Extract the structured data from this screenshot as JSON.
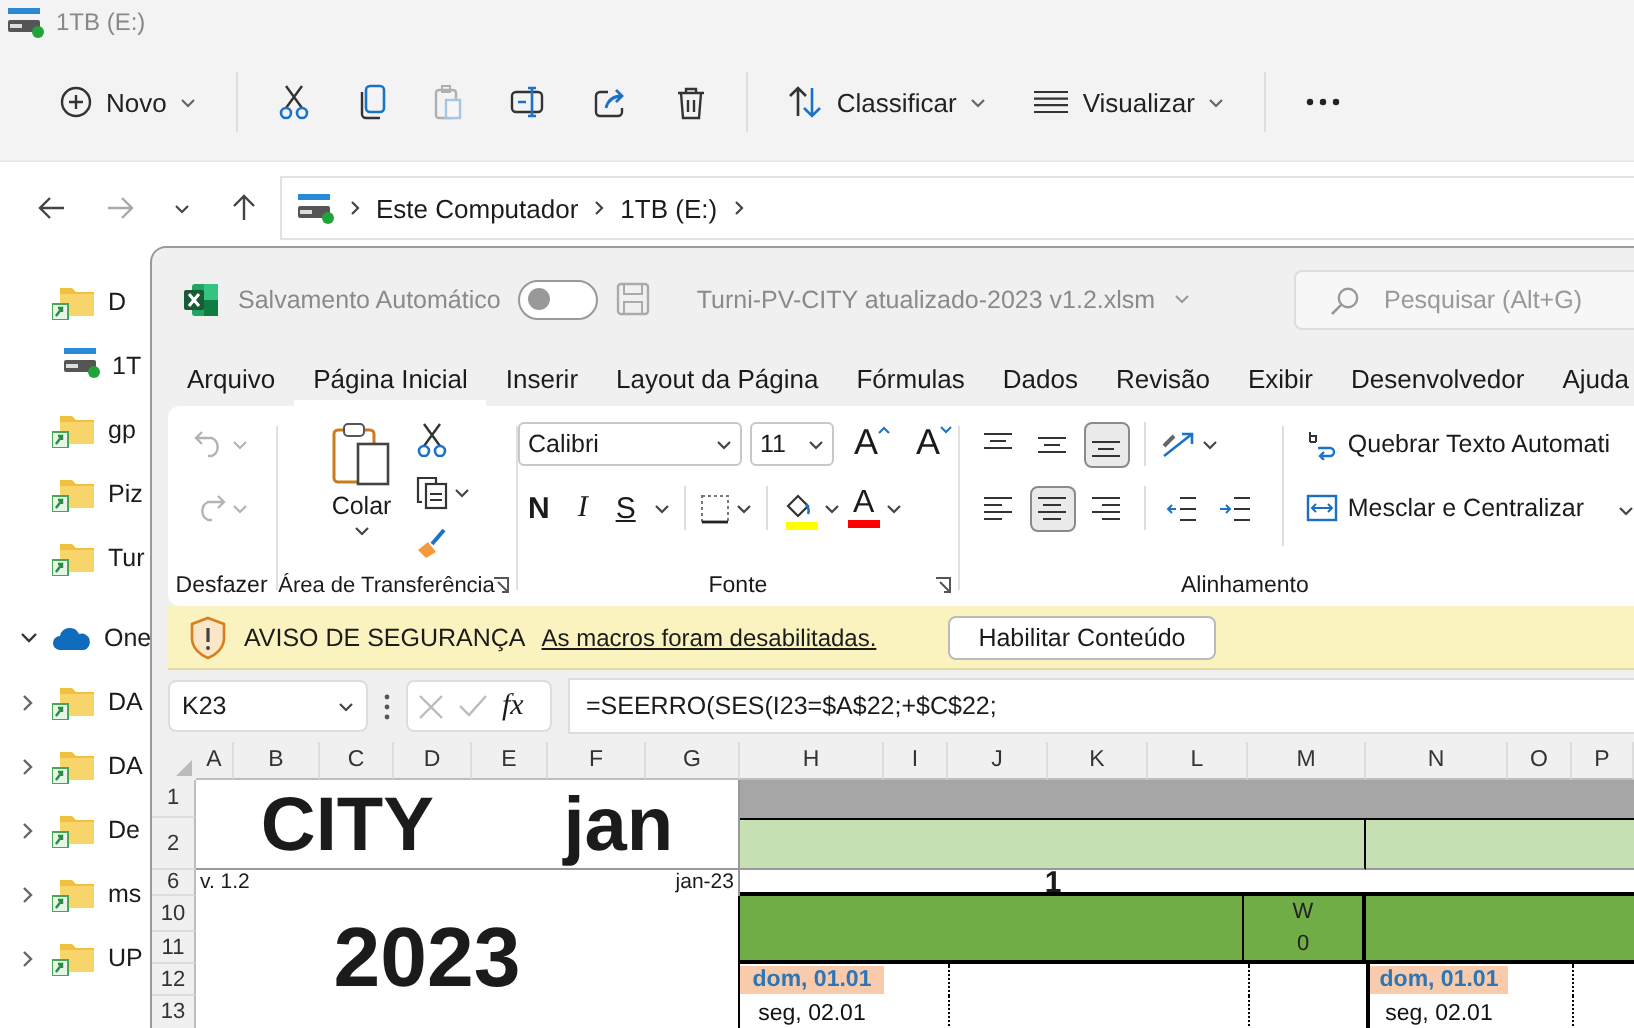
{
  "explorer": {
    "title": "1TB (E:)",
    "toolbar": [
      [
        {
          "kind": "new",
          "label": "Novo",
          "disabled": false
        }
      ],
      [
        {
          "kind": "cut",
          "disabled": false
        },
        {
          "kind": "copy",
          "disabled": false
        },
        {
          "kind": "paste",
          "disabled": true
        },
        {
          "kind": "rename",
          "disabled": false
        },
        {
          "kind": "share",
          "disabled": false
        },
        {
          "kind": "delete",
          "disabled": false
        }
      ],
      [
        {
          "kind": "sort",
          "label": "Classificar",
          "disabled": false
        },
        {
          "kind": "view",
          "label": "Visualizar",
          "disabled": false
        }
      ],
      [
        {
          "kind": "more",
          "disabled": false
        }
      ]
    ],
    "address": {
      "crumbs": [
        "Este Computador",
        "1TB (E:)"
      ]
    },
    "sidebar": [
      {
        "kind": "folder",
        "label": "D"
      },
      {
        "kind": "drive",
        "label": "1T"
      },
      {
        "kind": "folder",
        "label": "gp"
      },
      {
        "kind": "folder",
        "label": "Piz"
      },
      {
        "kind": "folder",
        "label": "Tur"
      },
      {
        "kind": "cloud",
        "label": "One",
        "expanded": true
      },
      {
        "kind": "folder",
        "label": "DA",
        "expanded": false
      },
      {
        "kind": "folder",
        "label": "DA",
        "expanded": false
      },
      {
        "kind": "folder",
        "label": "De",
        "expanded": false
      },
      {
        "kind": "folder",
        "label": "ms",
        "expanded": false
      },
      {
        "kind": "folder",
        "label": "UP",
        "expanded": false
      }
    ]
  },
  "excel": {
    "autosave": {
      "label": "Salvamento Automático",
      "on": false
    },
    "filename": "Turni-PV-CITY atualizado-2023 v1.2.xlsm",
    "search": {
      "placeholder": "Pesquisar (Alt+G)"
    },
    "tabs": [
      {
        "label": "Arquivo",
        "selected": false
      },
      {
        "label": "Página Inicial",
        "selected": true
      },
      {
        "label": "Inserir",
        "selected": false
      },
      {
        "label": "Layout da Página",
        "selected": false
      },
      {
        "label": "Fórmulas",
        "selected": false
      },
      {
        "label": "Dados",
        "selected": false
      },
      {
        "label": "Revisão",
        "selected": false
      },
      {
        "label": "Exibir",
        "selected": false
      },
      {
        "label": "Desenvolvedor",
        "selected": false
      },
      {
        "label": "Ajuda",
        "selected": false
      }
    ],
    "ribbon": {
      "undo": {
        "label": "Desfazer",
        "disabled": true
      },
      "clipboard": {
        "label": "Área de Transferência",
        "paste": "Colar"
      },
      "font": {
        "label": "Fonte",
        "family": "Calibri",
        "size": "11",
        "grow": "A",
        "shrink": "A",
        "styles": [
          "N",
          "I",
          "S"
        ],
        "color_glyph": "A"
      },
      "alignment": {
        "label": "Alinhamento",
        "vertical": [
          {
            "kind": "top",
            "selected": false
          },
          {
            "kind": "middle",
            "selected": false
          },
          {
            "kind": "bottom",
            "selected": true
          }
        ],
        "horizontal": [
          {
            "kind": "left",
            "selected": false
          },
          {
            "kind": "center",
            "selected": true
          },
          {
            "kind": "right",
            "selected": false
          }
        ],
        "wrap": "Quebrar Texto Automati",
        "merge": "Mesclar e Centralizar"
      }
    },
    "security": {
      "title": "AVISO DE SEGURANÇA",
      "message": "As macros foram desabilitadas.",
      "button": "Habilitar Conteúdo"
    },
    "formula_bar": {
      "name_box": "K23",
      "fx": "fx",
      "formula": "=SEERRO(SES(I23=$A$22;+$C$22;"
    },
    "sheet": {
      "columns": [
        "A",
        "B",
        "C",
        "D",
        "E",
        "F",
        "G",
        "H",
        "I",
        "J",
        "K",
        "L",
        "M",
        "N",
        "O",
        "P"
      ],
      "rows": [
        "1",
        "2",
        "6",
        "10",
        "11",
        "12",
        "13"
      ],
      "title": [
        "CITY",
        "jan"
      ],
      "version": "v. 1.2",
      "month": "jan-23",
      "year": "2023",
      "weeks": [
        {
          "number": "1",
          "shift": {
            "letter": "W",
            "count": "0"
          },
          "days": [
            {
              "label": "dom, 01.01",
              "holiday": true
            },
            {
              "label": "seg, 02.01",
              "holiday": false
            }
          ]
        },
        {
          "days": [
            {
              "label": "dom, 01.01",
              "holiday": true
            },
            {
              "label": "seg, 02.01",
              "holiday": false
            }
          ]
        }
      ]
    }
  }
}
